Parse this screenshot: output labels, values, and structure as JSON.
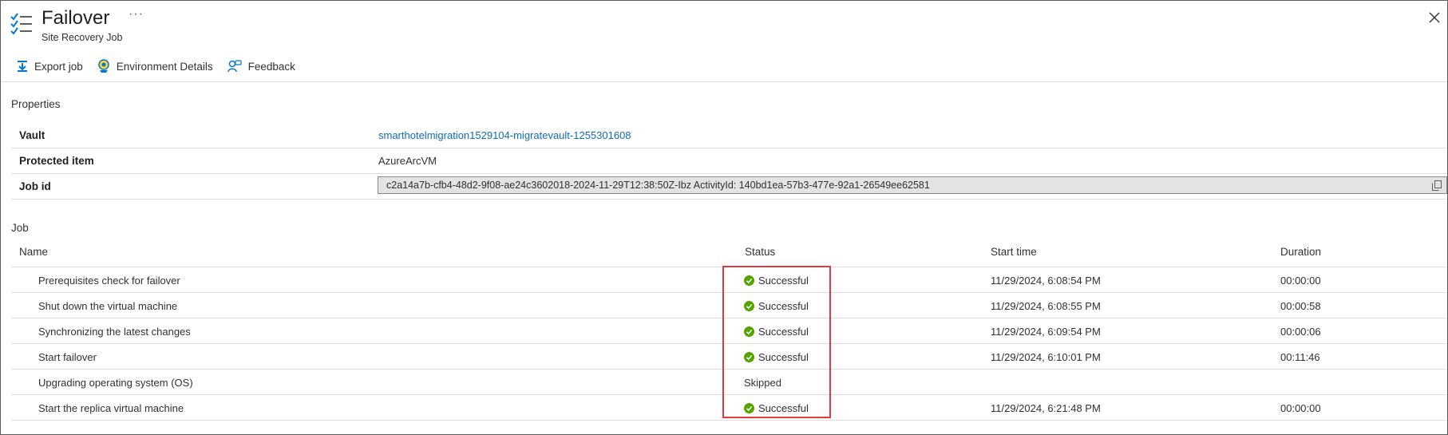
{
  "header": {
    "title": "Failover",
    "subtitle": "Site Recovery Job",
    "more_label": "···"
  },
  "toolbar": {
    "export_label": "Export job",
    "environment_label": "Environment Details",
    "feedback_label": "Feedback"
  },
  "properties": {
    "section_label": "Properties",
    "vault_label": "Vault",
    "vault_value": "smarthotelmigration1529104-migratevault-1255301608",
    "protected_item_label": "Protected item",
    "protected_item_value": "AzureArcVM",
    "job_id_label": "Job id",
    "job_id_value": "c2a14a7b-cfb4-48d2-9f08-ae24c3602018-2024-11-29T12:38:50Z-Ibz ActivityId: 140bd1ea-57b3-477e-92a1-26549ee62581"
  },
  "job": {
    "section_label": "Job",
    "columns": {
      "name": "Name",
      "status": "Status",
      "start_time": "Start time",
      "duration": "Duration"
    },
    "rows": [
      {
        "name": "Prerequisites check for failover",
        "status": "Successful",
        "start_time": "11/29/2024, 6:08:54 PM",
        "duration": "00:00:00"
      },
      {
        "name": "Shut down the virtual machine",
        "status": "Successful",
        "start_time": "11/29/2024, 6:08:55 PM",
        "duration": "00:00:58"
      },
      {
        "name": "Synchronizing the latest changes",
        "status": "Successful",
        "start_time": "11/29/2024, 6:09:54 PM",
        "duration": "00:00:06"
      },
      {
        "name": "Start failover",
        "status": "Successful",
        "start_time": "11/29/2024, 6:10:01 PM",
        "duration": "00:11:46"
      },
      {
        "name": "Upgrading operating system (OS)",
        "status": "Skipped",
        "start_time": "",
        "duration": ""
      },
      {
        "name": "Start the replica virtual machine",
        "status": "Successful",
        "start_time": "11/29/2024, 6:21:48 PM",
        "duration": "00:00:00"
      }
    ]
  },
  "colors": {
    "link": "#0f6cbd",
    "success": "#57a300",
    "highlight_border": "#e03a3a"
  },
  "icons": {
    "header": "job-list-icon",
    "export": "download-icon",
    "environment": "environment-icon",
    "feedback": "feedback-icon",
    "close": "close-icon",
    "copy": "copy-icon",
    "status_success": "check-circle-icon"
  }
}
